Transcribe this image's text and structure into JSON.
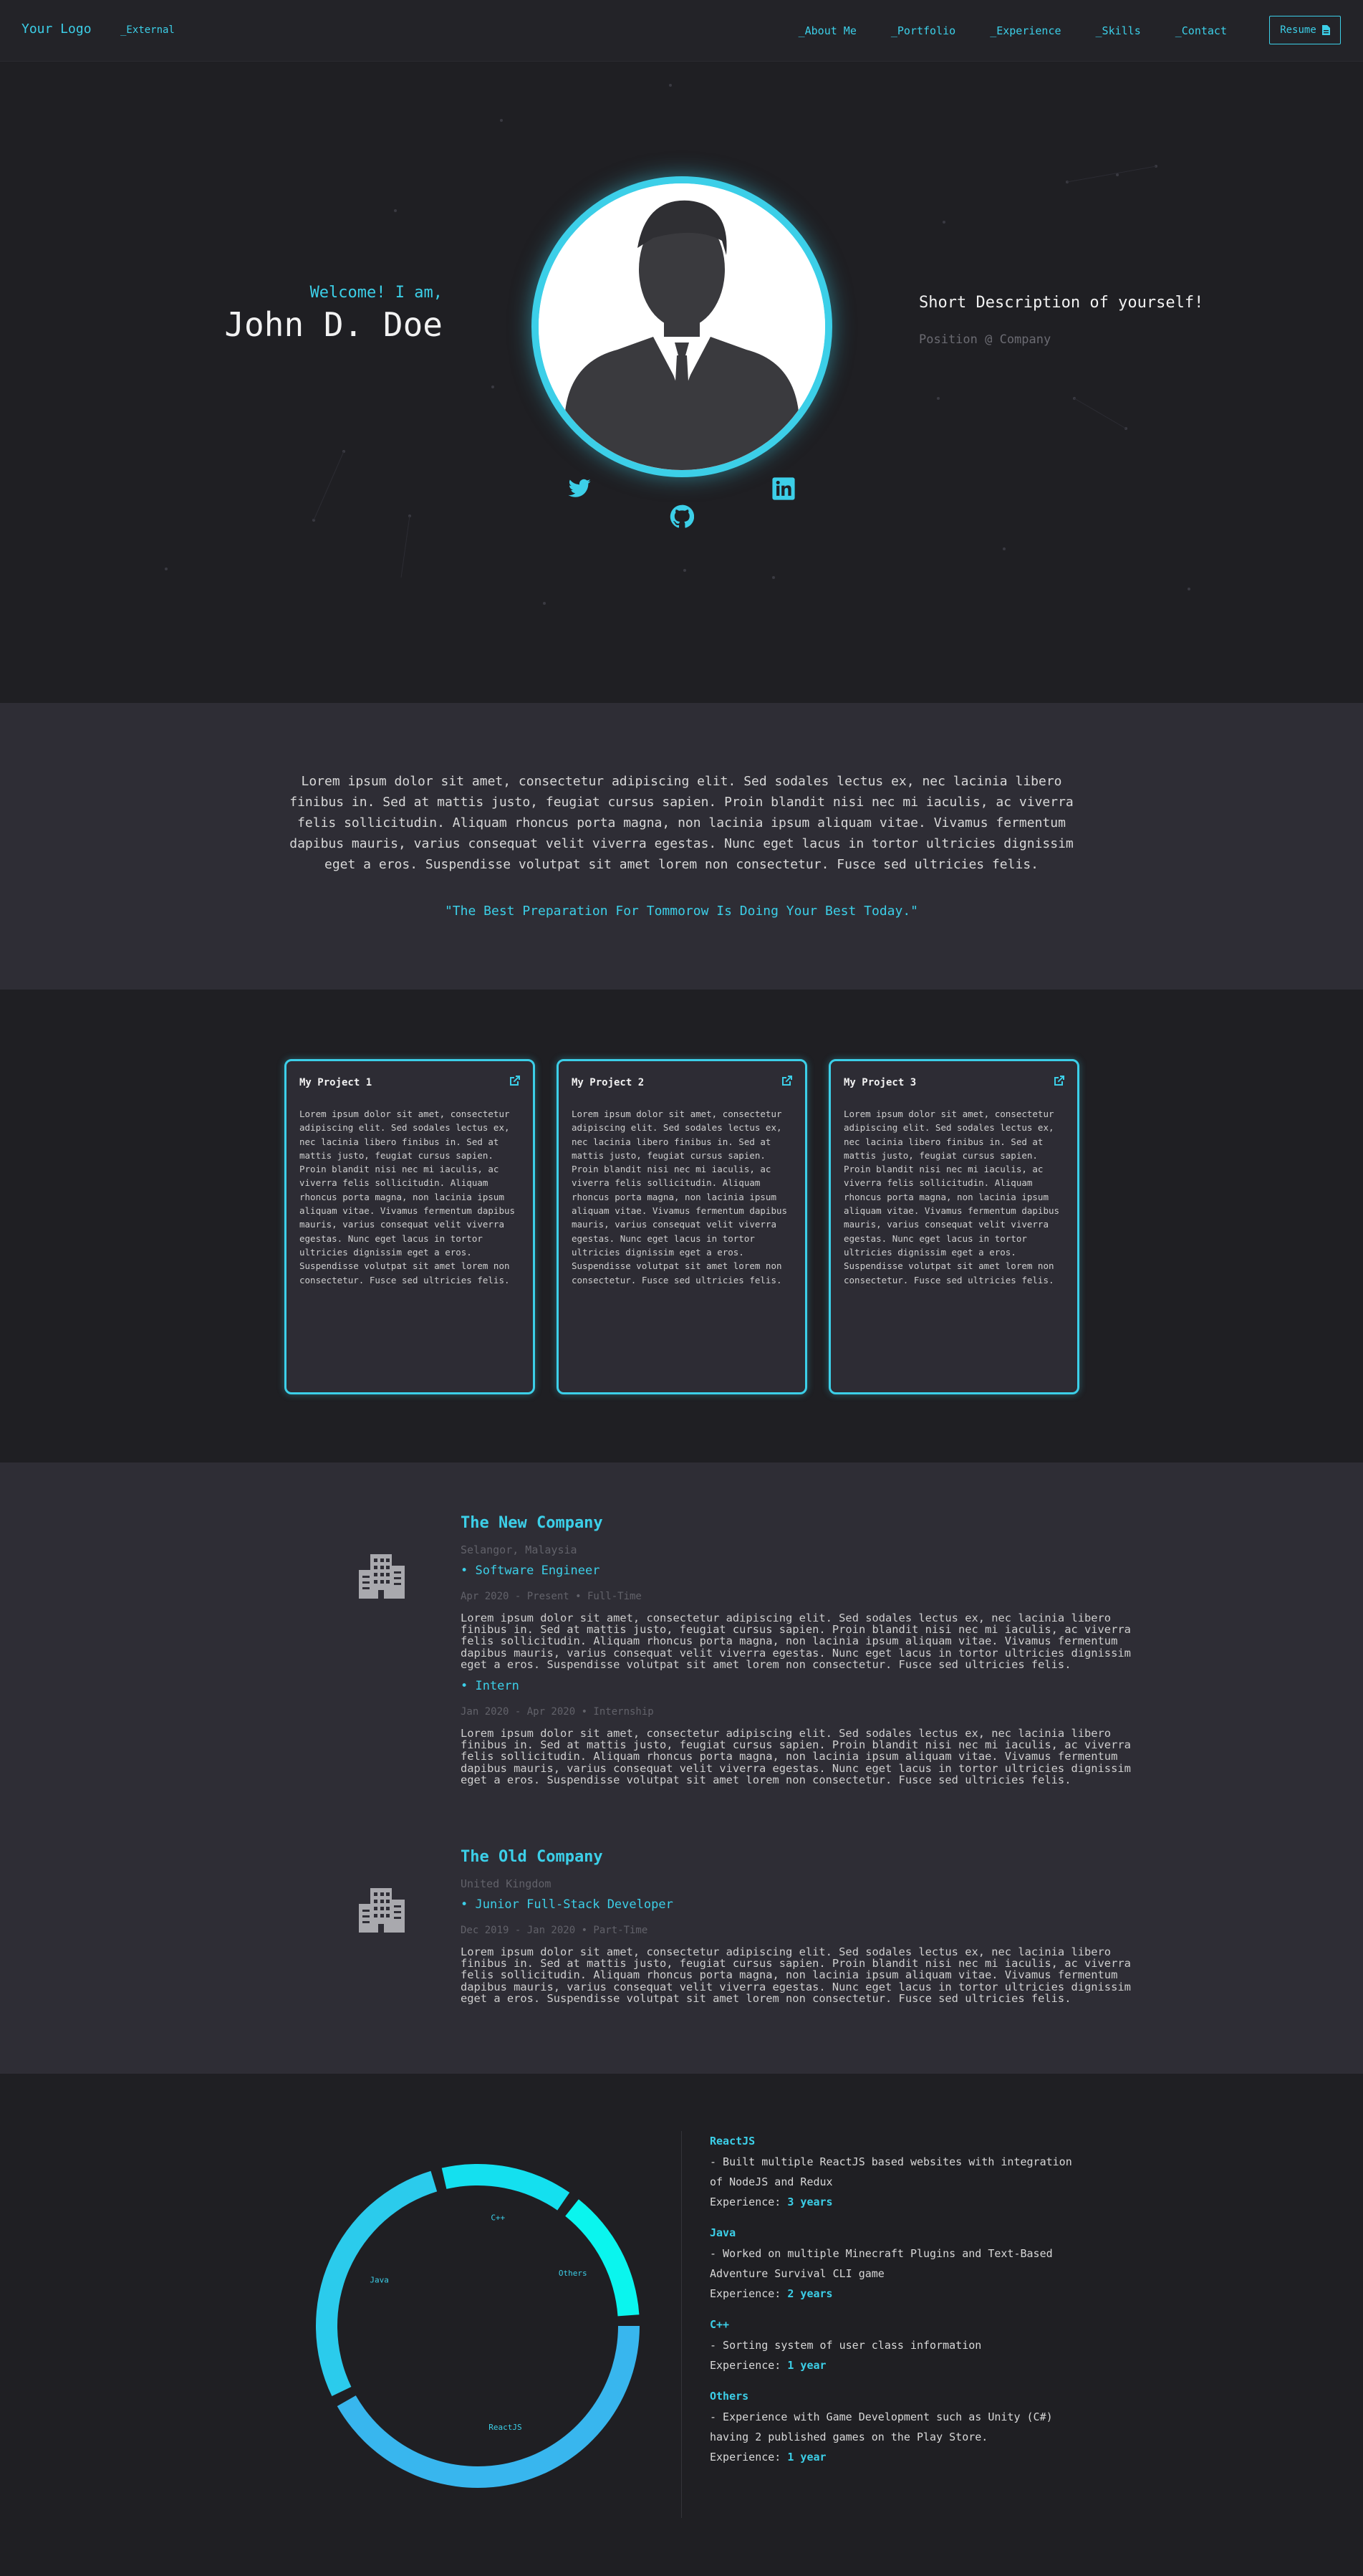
{
  "nav": {
    "logo": "Your Logo",
    "external": "_External",
    "links": [
      "_About Me",
      "_Portfolio",
      "_Experience",
      "_Skills",
      "_Contact"
    ],
    "resume": "Resume"
  },
  "hero": {
    "welcome": "Welcome! I am,",
    "name": "John D. Doe",
    "short_description": "Short Description of yourself!",
    "position": "Position @ Company",
    "social_icons": [
      "twitter-icon",
      "github-icon",
      "linkedin-icon"
    ]
  },
  "about": {
    "text": "Lorem ipsum dolor sit amet, consectetur adipiscing elit. Sed sodales lectus ex, nec lacinia libero finibus in. Sed at mattis justo, feugiat cursus sapien. Proin blandit nisi nec mi iaculis, ac viverra felis sollicitudin. Aliquam rhoncus porta magna, non lacinia ipsum aliquam vitae. Vivamus fermentum dapibus mauris, varius consequat velit viverra egestas. Nunc eget lacus in tortor ultricies dignissim eget a eros. Suspendisse volutpat sit amet lorem non consectetur. Fusce sed ultricies felis.",
    "quote": "\"The Best Preparation For Tommorow Is Doing Your Best Today.\""
  },
  "portfolio": {
    "projects": [
      {
        "title": "My Project 1",
        "body": "Lorem ipsum dolor sit amet, consectetur adipiscing elit. Sed sodales lectus ex, nec lacinia libero finibus in. Sed at mattis justo, feugiat cursus sapien. Proin blandit nisi nec mi iaculis, ac viverra felis sollicitudin. Aliquam rhoncus porta magna, non lacinia ipsum aliquam vitae. Vivamus fermentum dapibus mauris, varius consequat velit viverra egestas. Nunc eget lacus in tortor ultricies dignissim eget a eros. Suspendisse volutpat sit amet lorem non consectetur. Fusce sed ultricies felis."
      },
      {
        "title": "My Project 2",
        "body": "Lorem ipsum dolor sit amet, consectetur adipiscing elit. Sed sodales lectus ex, nec lacinia libero finibus in. Sed at mattis justo, feugiat cursus sapien. Proin blandit nisi nec mi iaculis, ac viverra felis sollicitudin. Aliquam rhoncus porta magna, non lacinia ipsum aliquam vitae. Vivamus fermentum dapibus mauris, varius consequat velit viverra egestas. Nunc eget lacus in tortor ultricies dignissim eget a eros. Suspendisse volutpat sit amet lorem non consectetur. Fusce sed ultricies felis."
      },
      {
        "title": "My Project 3",
        "body": "Lorem ipsum dolor sit amet, consectetur adipiscing elit. Sed sodales lectus ex, nec lacinia libero finibus in. Sed at mattis justo, feugiat cursus sapien. Proin blandit nisi nec mi iaculis, ac viverra felis sollicitudin. Aliquam rhoncus porta magna, non lacinia ipsum aliquam vitae. Vivamus fermentum dapibus mauris, varius consequat velit viverra egestas. Nunc eget lacus in tortor ultricies dignissim eget a eros. Suspendisse volutpat sit amet lorem non consectetur. Fusce sed ultricies felis."
      }
    ]
  },
  "experience": {
    "companies": [
      {
        "name": "The New Company",
        "location": "Selangor, Malaysia",
        "roles": [
          {
            "title": "• Software Engineer",
            "dates": "Apr 2020 - Present • Full-Time",
            "desc": "Lorem ipsum dolor sit amet, consectetur adipiscing elit. Sed sodales lectus ex, nec lacinia libero finibus in. Sed at mattis justo, feugiat cursus sapien. Proin blandit nisi nec mi iaculis, ac viverra felis sollicitudin. Aliquam rhoncus porta magna, non lacinia ipsum aliquam vitae. Vivamus fermentum dapibus mauris, varius consequat velit viverra egestas. Nunc eget lacus in tortor ultricies dignissim eget a eros. Suspendisse volutpat sit amet lorem non consectetur. Fusce sed ultricies felis."
          },
          {
            "title": "• Intern",
            "dates": "Jan 2020 - Apr 2020 • Internship",
            "desc": "Lorem ipsum dolor sit amet, consectetur adipiscing elit. Sed sodales lectus ex, nec lacinia libero finibus in. Sed at mattis justo, feugiat cursus sapien. Proin blandit nisi nec mi iaculis, ac viverra felis sollicitudin. Aliquam rhoncus porta magna, non lacinia ipsum aliquam vitae. Vivamus fermentum dapibus mauris, varius consequat velit viverra egestas. Nunc eget lacus in tortor ultricies dignissim eget a eros. Suspendisse volutpat sit amet lorem non consectetur. Fusce sed ultricies felis."
          }
        ]
      },
      {
        "name": "The Old Company",
        "location": "United Kingdom",
        "roles": [
          {
            "title": "• Junior Full-Stack Developer",
            "dates": "Dec 2019 - Jan 2020 • Part-Time",
            "desc": "Lorem ipsum dolor sit amet, consectetur adipiscing elit. Sed sodales lectus ex, nec lacinia libero finibus in. Sed at mattis justo, feugiat cursus sapien. Proin blandit nisi nec mi iaculis, ac viverra felis sollicitudin. Aliquam rhoncus porta magna, non lacinia ipsum aliquam vitae. Vivamus fermentum dapibus mauris, varius consequat velit viverra egestas. Nunc eget lacus in tortor ultricies dignissim eget a eros. Suspendisse volutpat sit amet lorem non consectetur. Fusce sed ultricies felis."
          }
        ]
      }
    ]
  },
  "skills": {
    "items": [
      {
        "name": "ReactJS",
        "lines": [
          "- Built multiple ReactJS based websites with integration",
          "of NodeJS and Redux"
        ],
        "exp_label": "Experience: ",
        "exp_value": "3 years"
      },
      {
        "name": "Java",
        "lines": [
          "- Worked on multiple Minecraft Plugins and Text-Based",
          "Adventure Survival CLI game"
        ],
        "exp_label": "Experience: ",
        "exp_value": "2 years"
      },
      {
        "name": "C++",
        "lines": [
          "- Sorting system of user class information"
        ],
        "exp_label": "Experience: ",
        "exp_value": "1 year"
      },
      {
        "name": "Others",
        "lines": [
          "- Experience with Game Development such as Unity (C#)",
          "having 2 published games on the Play Store."
        ],
        "exp_label": "Experience: ",
        "exp_value": "1 year"
      }
    ]
  },
  "chart_data": {
    "type": "pie",
    "categories": [
      "ReactJS",
      "Java",
      "C++",
      "Others"
    ],
    "values": [
      3,
      2,
      1,
      1
    ],
    "colors": [
      "#38b6ee",
      "#2bcbec",
      "#14e0ef",
      "#0af5ee"
    ]
  },
  "colors": {
    "accent": "#3ccfe8",
    "bg": "#1f1f23",
    "panel": "#2e2d35"
  }
}
